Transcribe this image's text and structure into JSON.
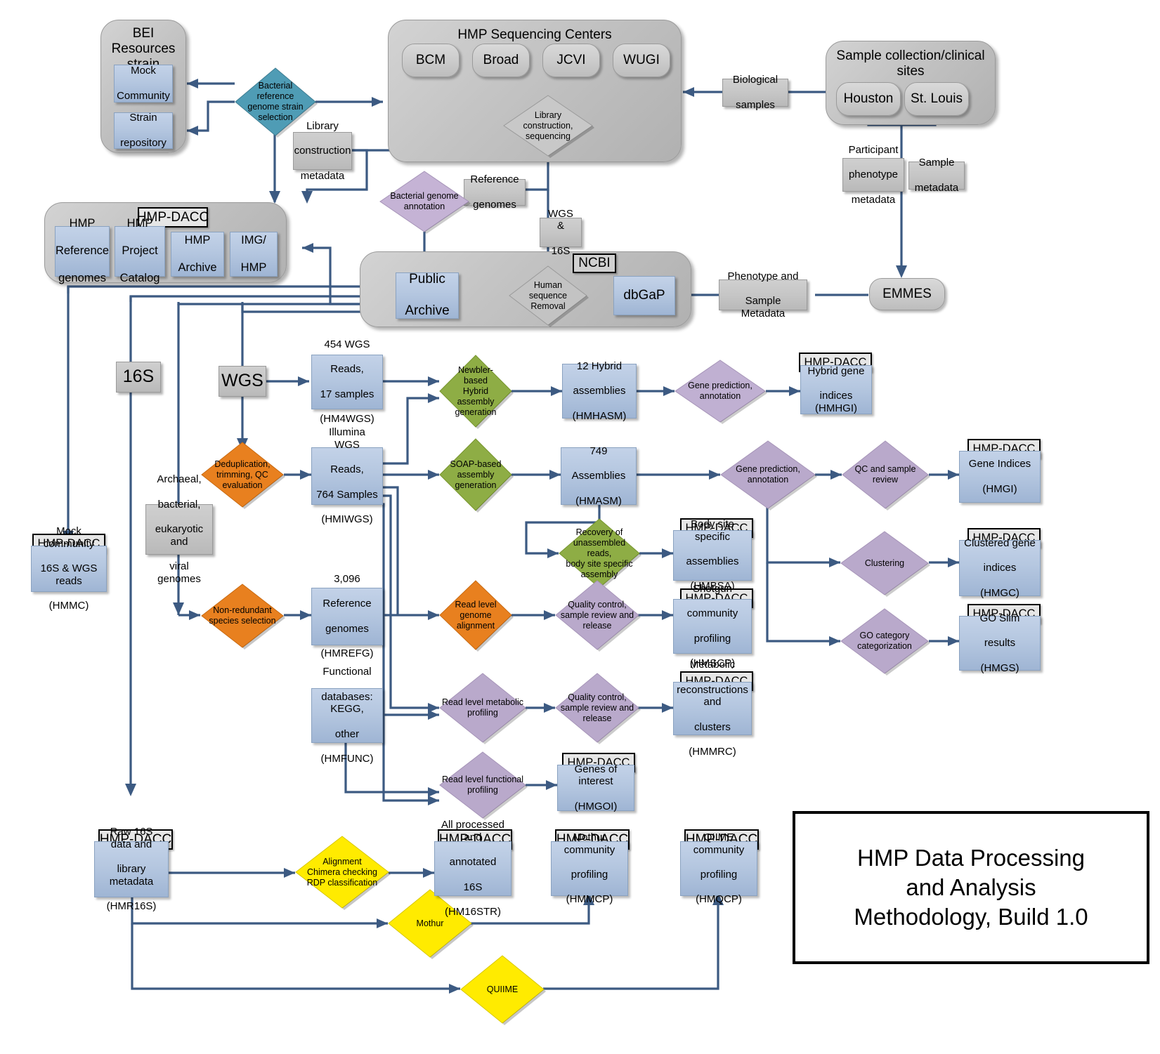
{
  "diagram": {
    "title_box": "HMP Data Processing and Analysis Methodology, Build 1.0",
    "title_lines": [
      "HMP Data Processing",
      "and Analysis",
      "Methodology, Build 1.0"
    ]
  },
  "groups": {
    "bei": {
      "title": "BEI Resources strain repository",
      "title_lines": [
        "BEI Resources",
        "strain",
        "repository"
      ]
    },
    "hmp_centers": {
      "title": "HMP Sequencing Centers"
    },
    "sample_sites": {
      "title": "Sample collection/clinical sites"
    },
    "hmp_dacc": {
      "title": "HMP-DACC"
    },
    "ncbi": {
      "title": "NCBI"
    }
  },
  "nodes": {
    "mock_community": "Mock Community",
    "strain_repository": "Strain repository",
    "bcm": "BCM",
    "broad": "Broad",
    "jcvi": "JCVI",
    "wugi": "WUGI",
    "library_construction_sequencing": "Library construction, sequencing",
    "bacterial_ref_strain_selection": "Bacterial reference genome strain selection",
    "library_construction_metadata": "Library construction metadata",
    "biological_samples": "Biological samples",
    "houston": "Houston",
    "st_louis": "St. Louis",
    "participant_phenotype_metadata": "Participant phenotype metadata",
    "sample_metadata": "Sample metadata",
    "bacterial_genome_annotation": "Bacterial genome annotation",
    "reference_genomes": "Reference genomes",
    "wgs_and_16s": "WGS & 16S",
    "hmp_reference_genomes": "HMP Reference genomes",
    "hmp_project_catalog": "HMP Project Catalog",
    "hmp_archive": "HMP Archive",
    "img_hmp": "IMG/ HMP",
    "public_archive": "Public Archive",
    "human_sequence_removal": "Human sequence Removal",
    "dbgap": "dbGaP",
    "phenotype_and_sample_metadata": "Phenotype and Sample Metadata",
    "emmes": "EMMES",
    "s16": "16S",
    "wgs": "WGS",
    "wgs454_reads": "454 WGS Reads, 17 samples (HM4WGS)",
    "newbler_hybrid": "Newbler-based Hybrid assembly generation",
    "hybrid_assemblies": "12 Hybrid assemblies (HMHASM)",
    "gene_prediction_annotation_top": "Gene prediction, annotation",
    "hybrid_gene_indices": "Hybrid gene indices (HMHGI)",
    "dedup_trim_qc": "Deduplication, trimming, QC evaluation",
    "illumina_wgs_reads": "Illumina WGS Reads, 764 Samples (HMIWGS)",
    "soap_assembly": "SOAP-based assembly generation",
    "assemblies_749": "749 Assemblies (HMASM)",
    "gene_prediction_annotation_mid": "Gene prediction, annotation",
    "qc_sample_review": "QC and sample review",
    "gene_indices": "Gene Indices (HMGI)",
    "clustering": "Clustering",
    "clustered_gene_indices": "Clustered gene indices (HMGC)",
    "go_category_categorization": "GO category categorization",
    "go_slim_results": "GO Slim results (HMGS)",
    "mock_community_reads": "Mock community 16S & WGS reads (HMMC)",
    "archaeal_bacterial": "Archaeal, bacterial, eukaryotic and viral genomes",
    "non_redundant_species": "Non-redundant species selection",
    "reference_genomes_3096": "3,096 Reference genomes (HMREFG)",
    "recovery_unassembled": "Recovery of unassembled reads, body site specific assembly",
    "body_site_assemblies": "Body site specific assemblies (HMBSA)",
    "read_level_genome_alignment": "Read level genome alignment",
    "qc_sample_review_release_1": "Quality control, sample review and release",
    "shotgun_community_profiling": "Shotgun community profiling (HMSCP)",
    "functional_databases": "Functional databases: KEGG, other (HMFUNC)",
    "read_level_metabolic_profiling": "Read level metabolic profiling",
    "qc_sample_review_release_2": "Quality control, sample review and release",
    "metabolic_reconstructions": "Metabolic reconstructions and clusters (HMMRC)",
    "read_level_functional_profiling": "Read level functional profiling",
    "genes_of_interest": "Genes of interest (HMGOI)",
    "raw_16s_data": "Raw 16S data and library metadata (HMR16S)",
    "alignment_chimera_rdp": "Alignment Chimera checking RDP classification",
    "all_processed_16s": "All processed and annotated 16S (HM16STR)",
    "mothur_community_profiling": "Mothur community profiling (HMMCP)",
    "qiime_community_profiling": "QIIME community profiling (HMQCP)",
    "mothur": "Mothur",
    "quiime": "QUIIME"
  },
  "node_lines": {
    "library_construction_sequencing": [
      "Library",
      "construction,",
      "sequencing"
    ],
    "bacterial_ref_strain_selection": [
      "Bacterial reference",
      "genome strain",
      "selection"
    ],
    "library_construction_metadata": [
      "Library",
      "construction",
      "metadata"
    ],
    "biological_samples": [
      "Biological",
      "samples"
    ],
    "participant_phenotype_metadata": [
      "Participant",
      "phenotype",
      "metadata"
    ],
    "sample_metadata": [
      "Sample",
      "metadata"
    ],
    "bacterial_genome_annotation": [
      "Bacterial genome",
      "annotation"
    ],
    "reference_genomes": [
      "Reference",
      "genomes"
    ],
    "wgs_and_16s": [
      "WGS &",
      "16S"
    ],
    "hmp_reference_genomes": [
      "HMP",
      "Reference",
      "genomes"
    ],
    "hmp_project_catalog": [
      "HMP",
      "Project",
      "Catalog"
    ],
    "hmp_archive": [
      "HMP",
      "Archive"
    ],
    "img_hmp": [
      "IMG/",
      "HMP"
    ],
    "public_archive": [
      "Public",
      "Archive"
    ],
    "human_sequence_removal": [
      "Human",
      "sequence",
      "Removal"
    ],
    "phenotype_and_sample_metadata": [
      "Phenotype and",
      "Sample Metadata"
    ],
    "mock_community": [
      "Mock",
      "Community"
    ],
    "strain_repository": [
      "Strain",
      "repository"
    ],
    "wgs454_reads": [
      "454 WGS",
      "Reads,",
      "17 samples",
      "(HM4WGS)"
    ],
    "newbler_hybrid": [
      "Newbler-based",
      "Hybrid assembly",
      "generation"
    ],
    "hybrid_assemblies": [
      "12 Hybrid",
      "assemblies",
      "(HMHASM)"
    ],
    "gene_prediction_annotation_top": [
      "Gene prediction,",
      "annotation"
    ],
    "hybrid_gene_indices": [
      "Hybrid gene",
      "indices (HMHGI)"
    ],
    "dedup_trim_qc": [
      "Deduplication,",
      "trimming, QC",
      "evaluation"
    ],
    "illumina_wgs_reads": [
      "Illumina WGS",
      "Reads,",
      "764 Samples",
      "(HMIWGS)"
    ],
    "soap_assembly": [
      "SOAP-based",
      "assembly",
      "generation"
    ],
    "assemblies_749": [
      "749",
      "Assemblies",
      "(HMASM)"
    ],
    "gene_prediction_annotation_mid": [
      "Gene prediction,",
      "annotation"
    ],
    "qc_sample_review": [
      "QC and sample",
      "review"
    ],
    "gene_indices": [
      "Gene Indices",
      "(HMGI)"
    ],
    "clustered_gene_indices": [
      "Clustered gene",
      "indices",
      "(HMGC)"
    ],
    "go_category_categorization": [
      "GO category",
      "categorization"
    ],
    "go_slim_results": [
      "GO Slim",
      "results",
      "(HMGS)"
    ],
    "mock_community_reads": [
      "Mock community",
      "16S & WGS reads",
      "(HMMC)"
    ],
    "archaeal_bacterial": [
      "Archaeal,",
      "bacterial,",
      "eukaryotic and",
      "viral genomes"
    ],
    "non_redundant_species": [
      "Non-redundant",
      "species selection"
    ],
    "reference_genomes_3096": [
      "3,096",
      "Reference",
      "genomes",
      "(HMREFG)"
    ],
    "recovery_unassembled": [
      "Recovery of",
      "unassembled reads,",
      "body site specific",
      "assembly"
    ],
    "body_site_assemblies": [
      "Body site specific",
      "assemblies",
      "(HMBSA)"
    ],
    "read_level_genome_alignment": [
      "Read level genome",
      "alignment"
    ],
    "qc_sample_review_release_1": [
      "Quality control,",
      "sample review and",
      "release"
    ],
    "shotgun_community_profiling": [
      "Shotgun",
      "community",
      "profiling",
      "(HMSCP)"
    ],
    "functional_databases": [
      "Functional",
      "databases: KEGG,",
      "other",
      "(HMFUNC)"
    ],
    "read_level_metabolic_profiling": [
      "Read level metabolic",
      "profiling"
    ],
    "qc_sample_review_release_2": [
      "Quality control,",
      "sample review and",
      "release"
    ],
    "metabolic_reconstructions": [
      "Metabolic",
      "reconstructions and",
      "clusters",
      "(HMMRC)"
    ],
    "read_level_functional_profiling": [
      "Read level functional",
      "profiling"
    ],
    "genes_of_interest": [
      "Genes of interest",
      "(HMGOI)"
    ],
    "raw_16s_data": [
      "Raw 16S data and",
      "library metadata",
      "(HMR16S)"
    ],
    "alignment_chimera_rdp": [
      "Alignment",
      "Chimera checking",
      "RDP classification"
    ],
    "all_processed_16s": [
      "All processed and",
      "annotated",
      "16S",
      "(HM16STR)"
    ],
    "mothur_community_profiling": [
      "Mothur community",
      "profiling",
      "(HMMCP)"
    ],
    "qiime_community_profiling": [
      "QIIME community",
      "profiling",
      "(HMQCP)"
    ]
  },
  "tags": {
    "dacc": "HMP-DACC",
    "ncbi": "NCBI"
  },
  "colors": {
    "blue_store": "#b5c7e0",
    "grey_label": "#c6c6c6",
    "teal_diamond": "#4f9cb5",
    "purple_diamond": "#b9a9cb",
    "green_diamond": "#8ead45",
    "orange_diamond": "#e8801f",
    "yellow_diamond": "#ffeb00",
    "connector": "#3c5a82",
    "title_border": "#000000"
  }
}
